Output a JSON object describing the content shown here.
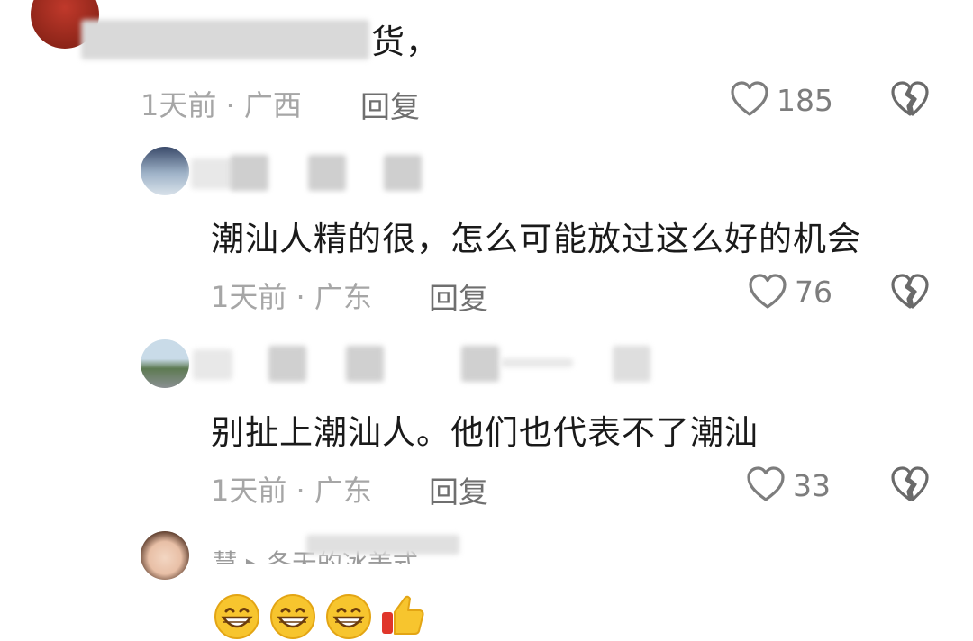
{
  "comments": [
    {
      "text_tail": "货，",
      "time": "1天前",
      "dot": "·",
      "location": "广西",
      "reply": "回复",
      "likes": "185"
    },
    {
      "text": "潮汕人精的很，怎么可能放过这么好的机会",
      "time": "1天前",
      "dot": "·",
      "location": "广东",
      "reply": "回复",
      "likes": "76"
    },
    {
      "text": "别扯上潮汕人。他们也代表不了潮汕",
      "time": "1天前",
      "dot": "·",
      "location": "广东",
      "reply": "回复",
      "likes": "33"
    },
    {
      "username_partial": "慧 ▸ 冬天的冰美式"
    }
  ],
  "icons": {
    "like": "heart-outline-icon",
    "dislike": "broken-heart-icon",
    "emoji": "grinning-face-emoji",
    "thumbs": "thumbs-up-emoji"
  },
  "colors": {
    "meta": "#a6a6a6",
    "reply": "#6f6f6f",
    "emoji_yellow": "#f7c52e"
  }
}
